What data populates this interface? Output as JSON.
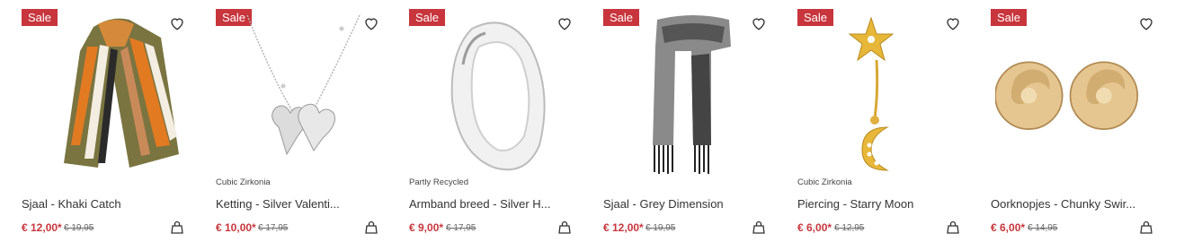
{
  "products": [
    {
      "badge": "Sale",
      "tag": "",
      "name": "Sjaal - Khaki Catch",
      "price": "€ 12,00*",
      "old_price": "€ 19,95",
      "image": "striped-scarf"
    },
    {
      "badge": "Sale",
      "tag": "Cubic Zirkonia",
      "name": "Ketting - Silver Valenti...",
      "price": "€ 10,00*",
      "old_price": "€ 17,95",
      "image": "heart-necklace"
    },
    {
      "badge": "Sale",
      "tag": "Partly Recycled",
      "name": "Armband breed - Silver H...",
      "price": "€ 9,00*",
      "old_price": "€ 17,95",
      "image": "silver-bangle"
    },
    {
      "badge": "Sale",
      "tag": "",
      "name": "Sjaal - Grey Dimension",
      "price": "€ 12,00*",
      "old_price": "€ 19,95",
      "image": "grey-scarf"
    },
    {
      "badge": "Sale",
      "tag": "Cubic Zirkonia",
      "name": "Piercing - Starry Moon",
      "price": "€ 6,00*",
      "old_price": "€ 12,95",
      "image": "star-moon-piercing"
    },
    {
      "badge": "Sale",
      "tag": "",
      "name": "Oorknopjes - Chunky Swir...",
      "price": "€ 6,00*",
      "old_price": "€ 14,95",
      "image": "gold-knot-earrings"
    }
  ],
  "icons": {
    "wishlist": "heart-icon",
    "cart": "shopping-bag-icon"
  },
  "colors": {
    "sale": "#c8353c",
    "text": "#333333"
  }
}
